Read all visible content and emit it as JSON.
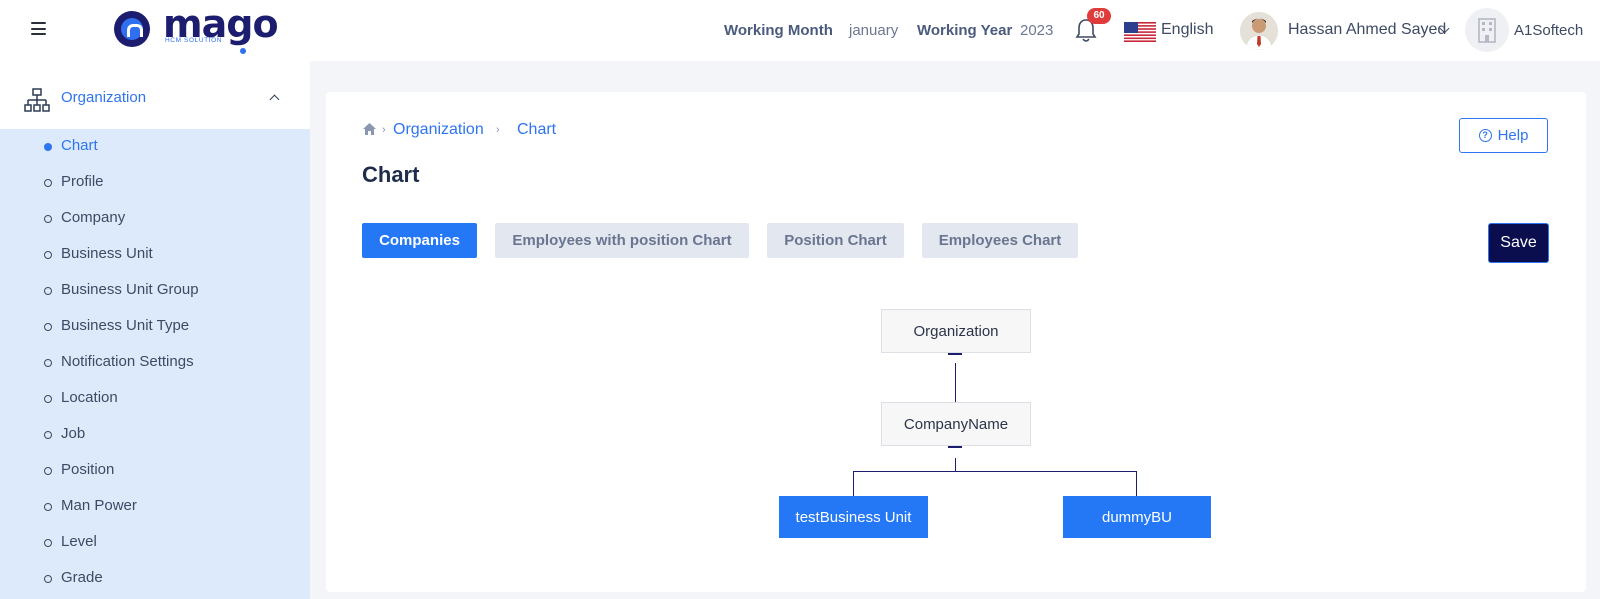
{
  "header": {
    "logo_text": "mago",
    "logo_subtitle": "HCM SOLUTION",
    "working_month_label": "Working Month",
    "working_month_value": "january",
    "working_year_label": "Working Year",
    "working_year_value": "2023",
    "notification_count": "60",
    "language": "English",
    "user_name": "Hassan Ahmed Sayed",
    "company": "A1Softech"
  },
  "sidebar": {
    "section_label": "Organization",
    "items": [
      {
        "label": "Chart",
        "active": true
      },
      {
        "label": "Profile"
      },
      {
        "label": "Company"
      },
      {
        "label": "Business Unit"
      },
      {
        "label": "Business Unit Group"
      },
      {
        "label": "Business Unit Type"
      },
      {
        "label": "Notification Settings"
      },
      {
        "label": "Location"
      },
      {
        "label": "Job"
      },
      {
        "label": "Position"
      },
      {
        "label": "Man Power"
      },
      {
        "label": "Level"
      },
      {
        "label": "Grade"
      }
    ]
  },
  "breadcrumb": {
    "items": [
      "Organization",
      "Chart"
    ]
  },
  "page": {
    "title": "Chart",
    "help_label": "Help",
    "save_label": "Save"
  },
  "tabs": [
    {
      "label": "Companies",
      "active": true
    },
    {
      "label": "Employees with position Chart"
    },
    {
      "label": "Position Chart"
    },
    {
      "label": "Employees Chart"
    }
  ],
  "org_chart": {
    "root": "Organization",
    "company": "CompanyName",
    "units": [
      "testBusiness Unit",
      "dummyBU"
    ]
  },
  "colors": {
    "primary": "#2478f5",
    "dark_navy": "#0a0e4f",
    "sidebar_bg": "#ddeafb",
    "badge": "#e03b3b"
  }
}
